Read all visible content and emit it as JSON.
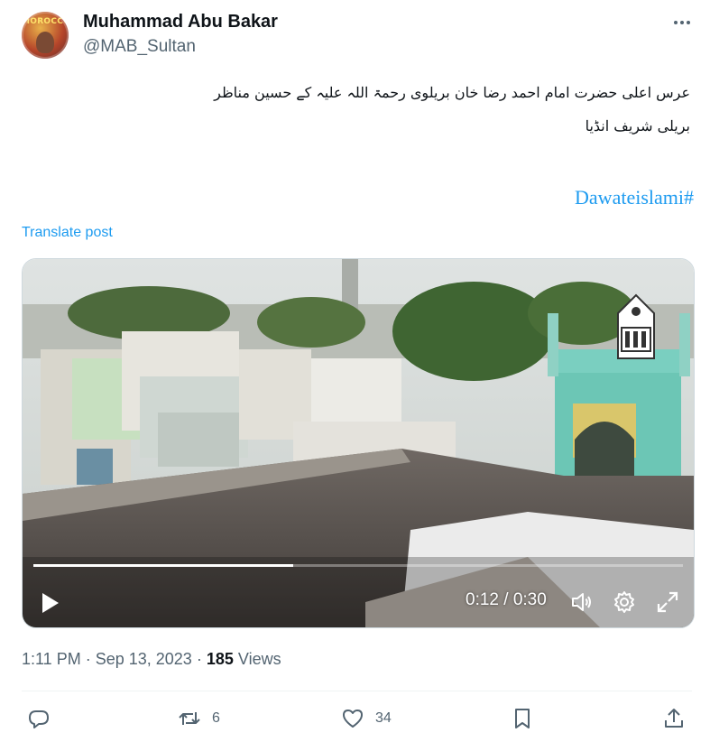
{
  "author": {
    "name": "Muhammad Abu Bakar",
    "handle": "@MAB_Sultan",
    "avatar_label": "MOROCCO"
  },
  "post": {
    "line1": "عرس اعلی حضرت امام احمد رضا خان بریلوی رحمۃ اللہ علیہ کے حسین مناظر",
    "line2": "بریلی شریف انڈیا",
    "hashtag": "Dawateislami#",
    "translate_label": "Translate post"
  },
  "video": {
    "current_time": "0:12",
    "duration": "0:30",
    "time_display": "0:12 / 0:30",
    "progress": 0.4
  },
  "meta": {
    "time": "1:11 PM",
    "date": "Sep 13, 2023",
    "views_count": "185",
    "views_label": "Views"
  },
  "actions": {
    "retweet_count": "6",
    "like_count": "34"
  },
  "colors": {
    "accent": "#1d9bf0",
    "text": "#0f1419",
    "muted": "#536471"
  }
}
